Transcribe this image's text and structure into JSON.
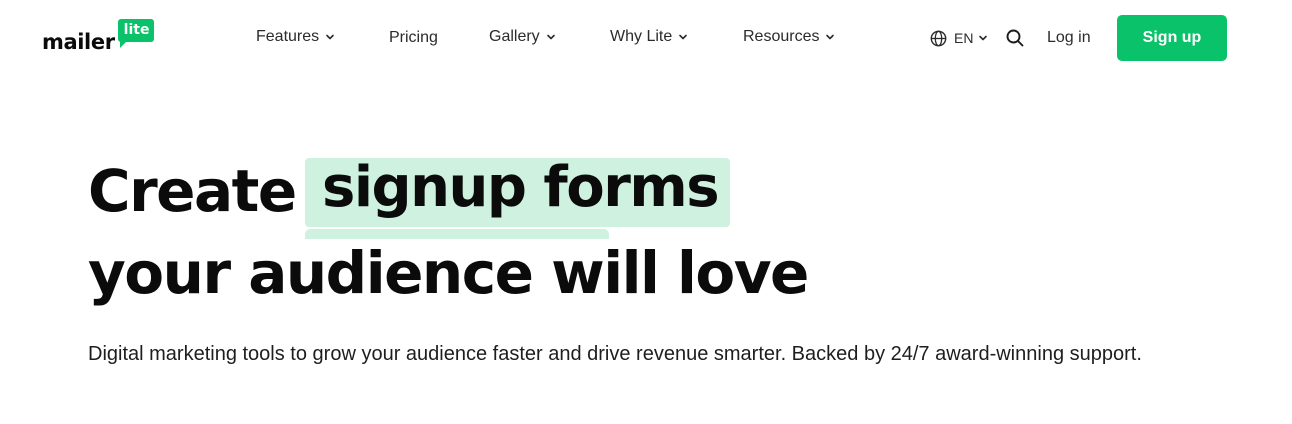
{
  "header": {
    "logo": {
      "word": "mailer",
      "badge": "lite"
    },
    "nav": {
      "features": "Features",
      "pricing": "Pricing",
      "gallery": "Gallery",
      "why_lite": "Why Lite",
      "resources": "Resources"
    },
    "language": "EN",
    "login": "Log in",
    "signup": "Sign up"
  },
  "hero": {
    "title_prefix": "Create",
    "title_highlight": "signup forms",
    "title_line2": "your audience will love",
    "subtitle": "Digital marketing tools to grow your audience faster and drive revenue smarter. Backed by 24/7 award-winning support."
  },
  "colors": {
    "brand_green": "#09c269",
    "highlight_mint": "#cff2e0",
    "text_dark": "#0b0b0b"
  },
  "icons": [
    "chevron-down-icon",
    "globe-icon",
    "search-icon"
  ]
}
